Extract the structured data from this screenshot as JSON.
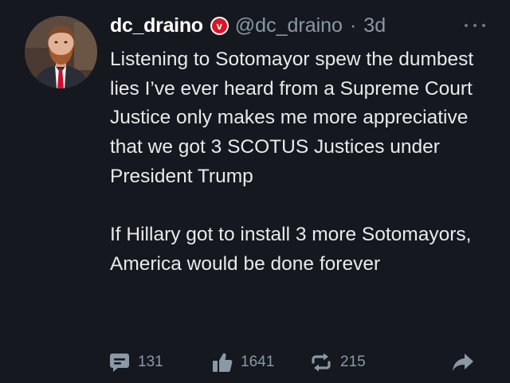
{
  "post": {
    "display_name": "dc_draino",
    "verified_badge_letter": "v",
    "handle": "@dc_draino",
    "separator": "·",
    "timestamp": "3d",
    "paragraphs": [
      "Listening to Sotomayor spew the dumbest lies I’ve ever heard from a Supreme Court Justice only makes me more appreciative that we got 3 SCOTUS Justices under President Trump",
      "If Hillary got to install 3 more Sotomayors, America would be done forever"
    ],
    "actions": {
      "reply_count": "131",
      "like_count": "1641",
      "repost_count": "215"
    }
  },
  "icons": {
    "avatar": "profile-photo",
    "verified": "verified-badge-icon",
    "more": "more-horizontal-icon",
    "reply": "comment-icon",
    "like": "thumbs-up-icon",
    "repost": "repost-icon",
    "share": "share-arrow-icon"
  },
  "colors": {
    "background": "#15181f",
    "text": "#e7e9ea",
    "muted": "#8b98a5",
    "verified_red": "#d9152a"
  }
}
